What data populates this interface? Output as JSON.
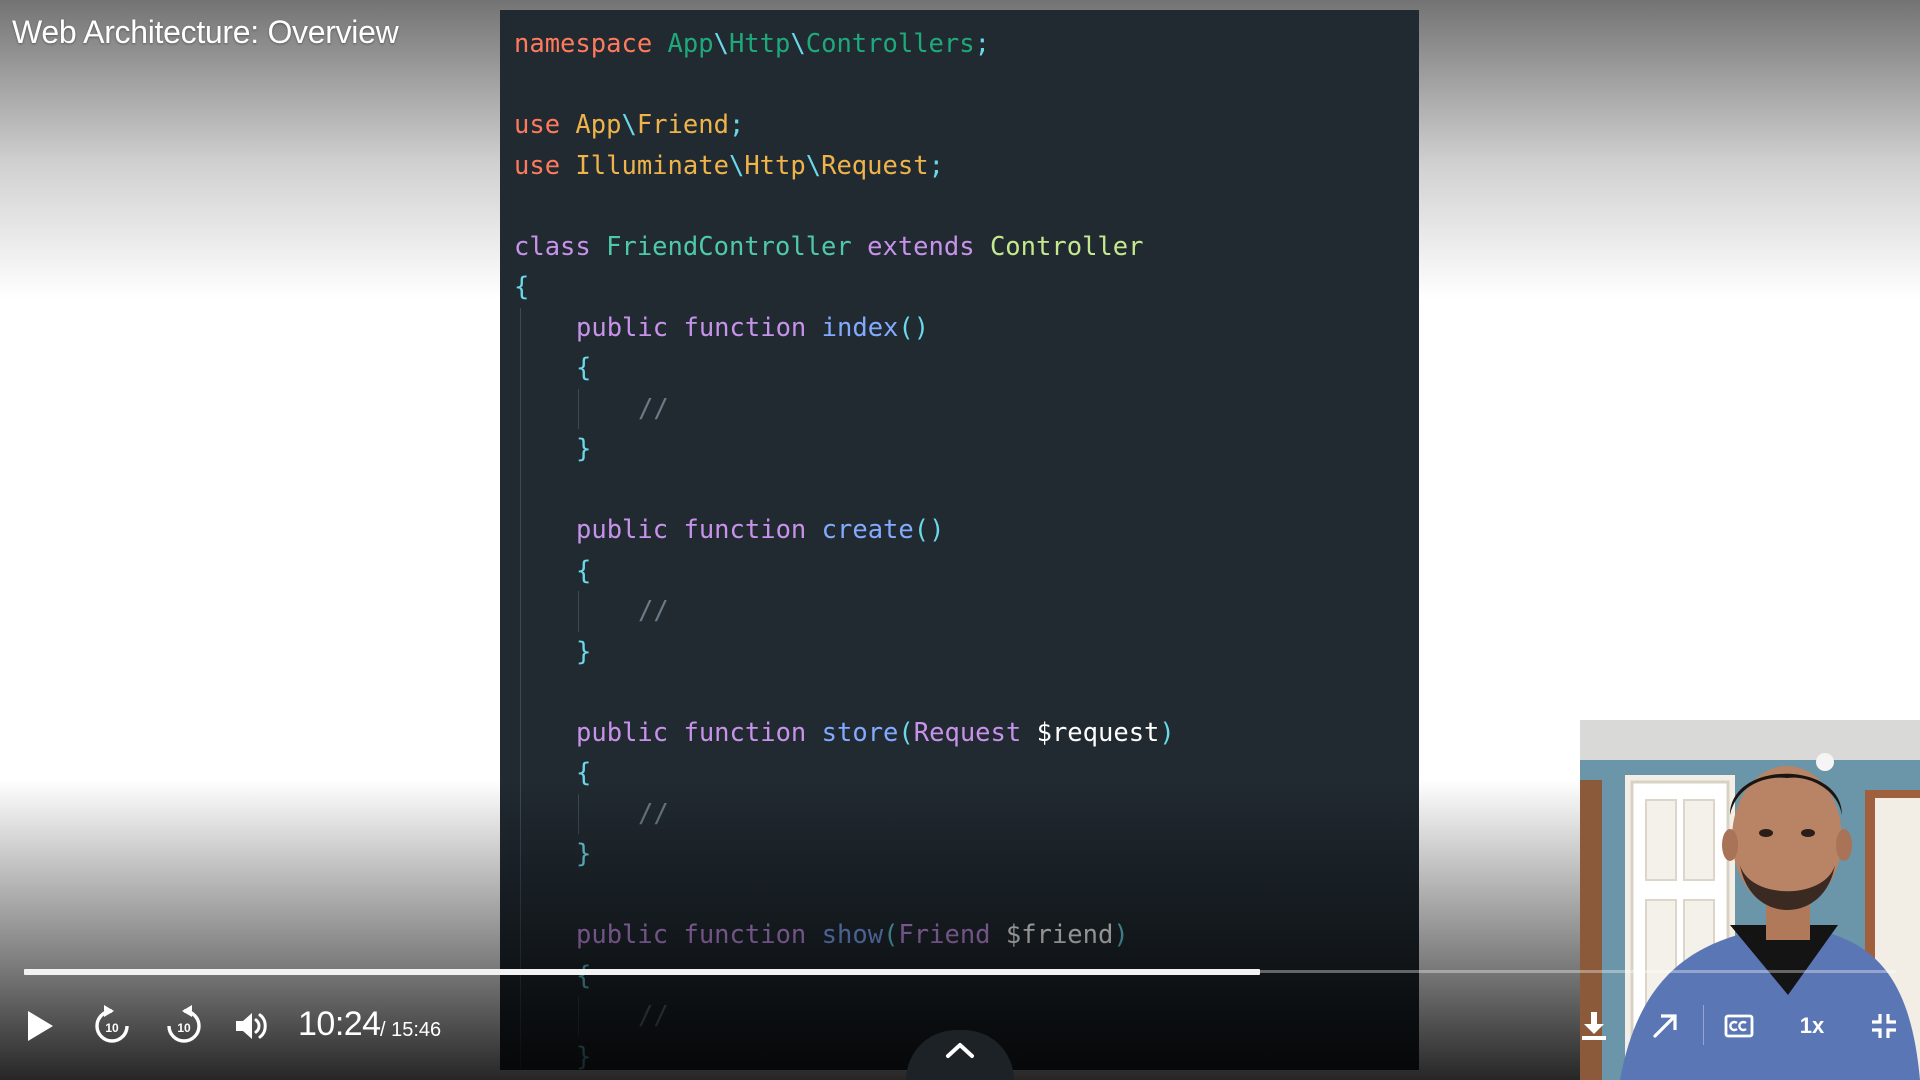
{
  "video": {
    "title": "Web Architecture: Overview",
    "current_time": "10:24",
    "total_time_label": "/ 15:46",
    "progress": 0.66,
    "speed_label": "1x"
  },
  "colors": {
    "keyword_ns": "#ff7a5c",
    "namespace_path": "#1fa97a",
    "separator": "#6bd8e8",
    "use_keyword": "#ff7a5c",
    "class_ref": "#f0b34a",
    "class_keyword": "#c792ea",
    "class_name": "#4ec9a8",
    "extends_keyword": "#c792ea",
    "parent_class": "#c3e88d",
    "brace": "#6bd8e8",
    "method_keyword": "#c792ea",
    "method_name": "#82aaff",
    "type_name": "#c792ea",
    "variable": "#ffffff",
    "comment": "#6b7a86",
    "punct": "#6bd8e8"
  },
  "code": {
    "lines": [
      {
        "row": 0,
        "indent": 0,
        "tokens": [
          [
            "namespace ",
            "keyword_ns"
          ],
          [
            "App",
            "namespace_path"
          ],
          [
            "\\",
            "separator"
          ],
          [
            "Http",
            "namespace_path"
          ],
          [
            "\\",
            "separator"
          ],
          [
            "Controllers",
            "namespace_path"
          ],
          [
            ";",
            "separator"
          ]
        ]
      },
      {
        "row": 2,
        "indent": 0,
        "tokens": [
          [
            "use ",
            "use_keyword"
          ],
          [
            "App",
            "class_ref"
          ],
          [
            "\\",
            "separator"
          ],
          [
            "Friend",
            "class_ref"
          ],
          [
            ";",
            "punct"
          ]
        ]
      },
      {
        "row": 3,
        "indent": 0,
        "tokens": [
          [
            "use ",
            "use_keyword"
          ],
          [
            "Illuminate",
            "class_ref"
          ],
          [
            "\\",
            "separator"
          ],
          [
            "Http",
            "class_ref"
          ],
          [
            "\\",
            "separator"
          ],
          [
            "Request",
            "class_ref"
          ],
          [
            ";",
            "punct"
          ]
        ]
      },
      {
        "row": 5,
        "indent": 0,
        "tokens": [
          [
            "class ",
            "class_keyword"
          ],
          [
            "FriendController ",
            "class_name"
          ],
          [
            "extends ",
            "extends_keyword"
          ],
          [
            "Controller",
            "parent_class"
          ]
        ]
      },
      {
        "row": 6,
        "indent": 0,
        "tokens": [
          [
            "{",
            "brace"
          ]
        ]
      },
      {
        "row": 7,
        "indent": 1,
        "tokens": [
          [
            "public ",
            "method_keyword"
          ],
          [
            "function ",
            "method_keyword"
          ],
          [
            "index",
            "method_name"
          ],
          [
            "()",
            "punct"
          ]
        ]
      },
      {
        "row": 8,
        "indent": 1,
        "tokens": [
          [
            "{",
            "brace"
          ]
        ]
      },
      {
        "row": 9,
        "indent": 2,
        "tokens": [
          [
            "//",
            "comment"
          ]
        ]
      },
      {
        "row": 10,
        "indent": 1,
        "tokens": [
          [
            "}",
            "brace"
          ]
        ]
      },
      {
        "row": 12,
        "indent": 1,
        "tokens": [
          [
            "public ",
            "method_keyword"
          ],
          [
            "function ",
            "method_keyword"
          ],
          [
            "create",
            "method_name"
          ],
          [
            "()",
            "punct"
          ]
        ]
      },
      {
        "row": 13,
        "indent": 1,
        "tokens": [
          [
            "{",
            "brace"
          ]
        ]
      },
      {
        "row": 14,
        "indent": 2,
        "tokens": [
          [
            "//",
            "comment"
          ]
        ]
      },
      {
        "row": 15,
        "indent": 1,
        "tokens": [
          [
            "}",
            "brace"
          ]
        ]
      },
      {
        "row": 17,
        "indent": 1,
        "tokens": [
          [
            "public ",
            "method_keyword"
          ],
          [
            "function ",
            "method_keyword"
          ],
          [
            "store",
            "method_name"
          ],
          [
            "(",
            "punct"
          ],
          [
            "Request ",
            "type_name"
          ],
          [
            "$request",
            "variable"
          ],
          [
            ")",
            "punct"
          ]
        ]
      },
      {
        "row": 18,
        "indent": 1,
        "tokens": [
          [
            "{",
            "brace"
          ]
        ]
      },
      {
        "row": 19,
        "indent": 2,
        "tokens": [
          [
            "//",
            "comment"
          ]
        ]
      },
      {
        "row": 20,
        "indent": 1,
        "tokens": [
          [
            "}",
            "brace"
          ]
        ]
      },
      {
        "row": 22,
        "indent": 1,
        "tokens": [
          [
            "public ",
            "method_keyword"
          ],
          [
            "function ",
            "method_keyword"
          ],
          [
            "show",
            "method_name"
          ],
          [
            "(",
            "punct"
          ],
          [
            "Friend ",
            "type_name"
          ],
          [
            "$friend",
            "variable"
          ],
          [
            ")",
            "punct"
          ]
        ]
      },
      {
        "row": 23,
        "indent": 1,
        "tokens": [
          [
            "{",
            "brace"
          ]
        ]
      },
      {
        "row": 24,
        "indent": 2,
        "tokens": [
          [
            "//",
            "comment"
          ]
        ]
      },
      {
        "row": 25,
        "indent": 1,
        "tokens": [
          [
            "}",
            "brace"
          ]
        ]
      }
    ]
  },
  "controls": {
    "play": "play-icon",
    "rewind": "rewind-10-icon",
    "forward": "forward-10-icon",
    "volume": "volume-icon",
    "download": "download-icon",
    "popout": "popout-arrow-icon",
    "captions": "closed-captions-icon",
    "exit_fullscreen": "exit-fullscreen-icon",
    "expand_panel": "chevron-up-icon",
    "skip_amount": "10"
  }
}
